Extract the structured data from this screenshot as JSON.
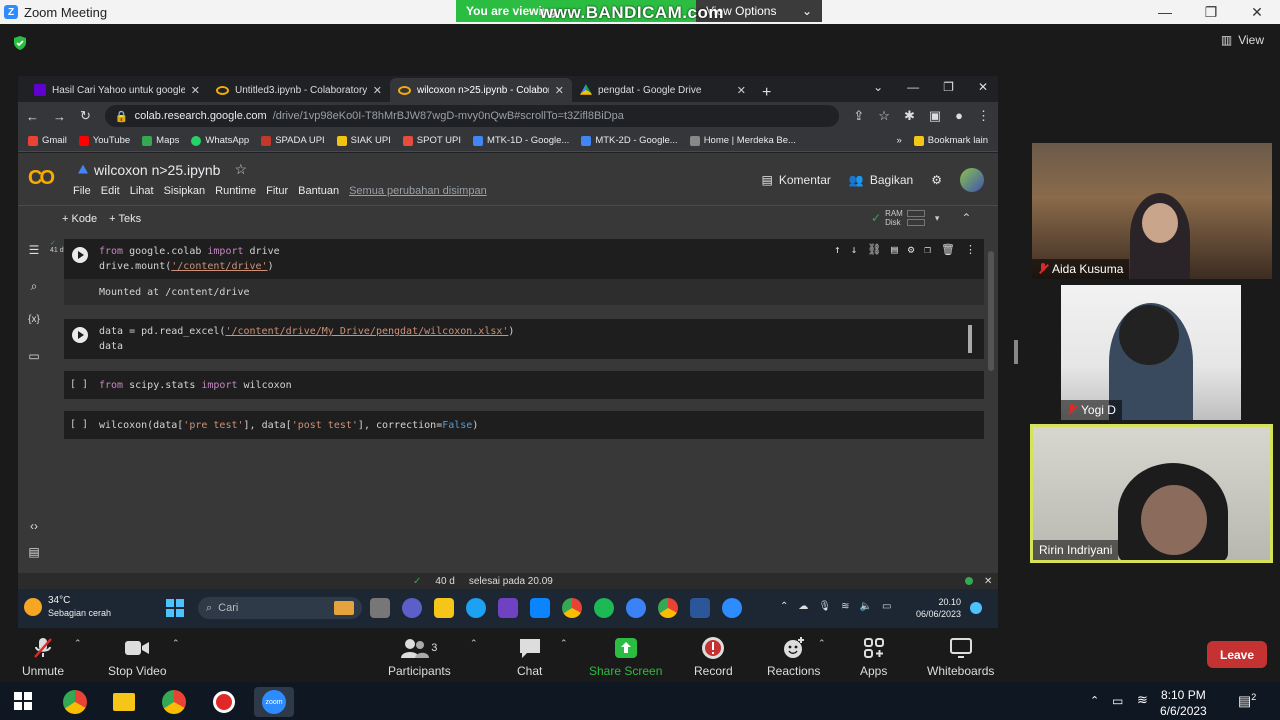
{
  "zoom": {
    "title": "Zoom Meeting",
    "banner_text": "You are viewing",
    "view_options": "View Options",
    "view_label": "View",
    "watermark": "www.BANDICAM.com"
  },
  "browser": {
    "tabs": [
      {
        "label": "Hasil Cari Yahoo untuk google c..."
      },
      {
        "label": "Untitled3.ipynb - Colaboratory"
      },
      {
        "label": "wilcoxon n>25.ipynb - Colaborat..."
      },
      {
        "label": "pengdat - Google Drive"
      }
    ],
    "url_host": "colab.research.google.com",
    "url_path": "/drive/1vp98eKo0I-T8hMrBJW87wgD-mvy0nQwB#scrollTo=t3Zifl8BiDpa",
    "bookmarks": [
      "Gmail",
      "YouTube",
      "Maps",
      "WhatsApp",
      "SPADA UPI",
      "SIAK UPI",
      "SPOT UPI",
      "MTK-1D - Google...",
      "MTK-2D - Google...",
      "Home | Merdeka Be...",
      "Bookmark lain"
    ]
  },
  "colab": {
    "notebook_title": "wilcoxon n>25.ipynb",
    "menu": [
      "File",
      "Edit",
      "Lihat",
      "Sisipkan",
      "Runtime",
      "Fitur",
      "Bantuan"
    ],
    "saved_status": "Semua perubahan disimpan",
    "comment": "Komentar",
    "share": "Bagikan",
    "add_code": "+ Kode",
    "add_text": "+ Teks",
    "ram": "RAM",
    "disk": "Disk",
    "exec_count": "41 d",
    "output1": "Mounted at /content/drive",
    "status_time": "40 d",
    "status_done": "selesai pada 20.09",
    "cell_bracket": "[ ]"
  },
  "inner_taskbar": {
    "temp": "34°C",
    "weather": "Sebagian cerah",
    "search": "Cari",
    "time": "20.10",
    "date": "06/06/2023"
  },
  "participants": [
    {
      "name": "Aida Kusuma"
    },
    {
      "name": "Yogi D"
    },
    {
      "name": "Ririn Indriyani"
    }
  ],
  "controls": {
    "unmute": "Unmute",
    "stop_video": "Stop Video",
    "participants": "Participants",
    "participants_count": "3",
    "chat": "Chat",
    "share_screen": "Share Screen",
    "record": "Record",
    "reactions": "Reactions",
    "apps": "Apps",
    "whiteboards": "Whiteboards",
    "leave": "Leave"
  },
  "taskbar": {
    "time": "8:10 PM",
    "date": "6/6/2023",
    "notif_count": "2"
  },
  "colors": {
    "share_green": "#2bbd41",
    "leave_red": "#c43232",
    "active_speaker": "#d6e35a"
  }
}
